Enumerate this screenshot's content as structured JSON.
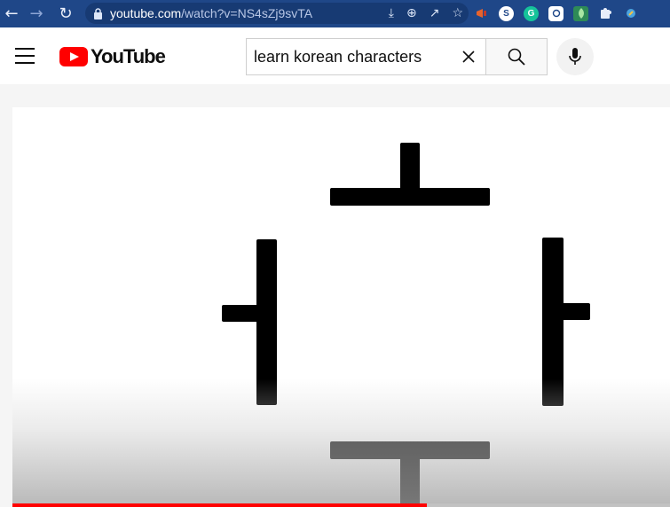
{
  "browser": {
    "url_host": "youtube.com",
    "url_path": "/watch?v=NS4sZj9svTA",
    "extensions": [
      {
        "name": "megaphone-extension-icon",
        "color": "#e8632b",
        "glyph": ""
      },
      {
        "name": "s-extension-icon",
        "color": "#5f6368",
        "glyph": "S"
      },
      {
        "name": "grammarly-extension-icon",
        "color": "#15c39a",
        "glyph": "G"
      },
      {
        "name": "bubble-extension-icon",
        "color": "#ffffff",
        "glyph": ""
      },
      {
        "name": "leaf-extension-icon",
        "color": "#2e8b57",
        "glyph": ""
      },
      {
        "name": "puzzle-extension-icon",
        "color": "#dfe6f3",
        "glyph": ""
      },
      {
        "name": "rocket-extension-icon",
        "color": "#4aa3df",
        "glyph": ""
      }
    ]
  },
  "header": {
    "logo_text": "YouTube",
    "search_value": "learn korean characters"
  },
  "player": {
    "progress_fraction": 0.63,
    "progress_color": "#ff0000"
  }
}
